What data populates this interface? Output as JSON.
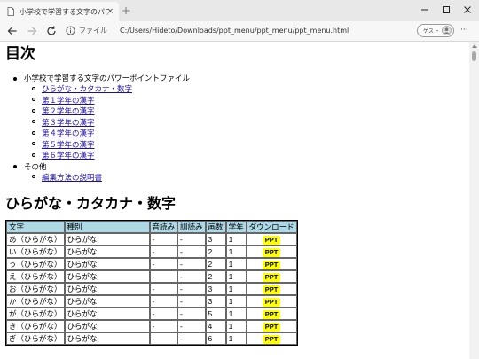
{
  "browser": {
    "tab_title": "小学校で学習する文字のパワーポイ",
    "tab_close": "×",
    "new_tab": "+",
    "scheme_label": "ファイル",
    "url": "C:/Users/Hideto/Downloads/ppt_menu/ppt_menu/ppt_menu.html",
    "guest_label": "ゲスト",
    "more": "···"
  },
  "toc": {
    "heading": "目次",
    "items": [
      {
        "label": "小学校で学習する文字のパワーポイントファイル",
        "children": [
          "ひらがな・カタカナ・数字",
          "第１学年の漢字",
          "第２学年の漢字",
          "第３学年の漢字",
          "第４学年の漢字",
          "第５学年の漢字",
          "第６学年の漢字"
        ]
      },
      {
        "label": "その他",
        "children": [
          "編集方法の説明書"
        ]
      }
    ]
  },
  "section": {
    "heading": "ひらがな・カタカナ・数字"
  },
  "table": {
    "headers": [
      "文字",
      "種別",
      "音読み",
      "訓読み",
      "画数",
      "学年",
      "ダウンロード"
    ],
    "download_label": "PPT",
    "rows": [
      [
        "あ（ひらがな）",
        "ひらがな",
        "-",
        "-",
        "3",
        "1"
      ],
      [
        "い（ひらがな）",
        "ひらがな",
        "-",
        "-",
        "2",
        "1"
      ],
      [
        "う（ひらがな）",
        "ひらがな",
        "-",
        "-",
        "2",
        "1"
      ],
      [
        "え（ひらがな）",
        "ひらがな",
        "-",
        "-",
        "2",
        "1"
      ],
      [
        "お（ひらがな）",
        "ひらがな",
        "-",
        "-",
        "3",
        "1"
      ],
      [
        "か（ひらがな）",
        "ひらがな",
        "-",
        "-",
        "3",
        "1"
      ],
      [
        "が（ひらがな）",
        "ひらがな",
        "-",
        "-",
        "5",
        "1"
      ],
      [
        "き（ひらがな）",
        "ひらがな",
        "-",
        "-",
        "4",
        "1"
      ],
      [
        "ぎ（ひらがな）",
        "ひらがな",
        "-",
        "-",
        "6",
        "1"
      ]
    ]
  }
}
